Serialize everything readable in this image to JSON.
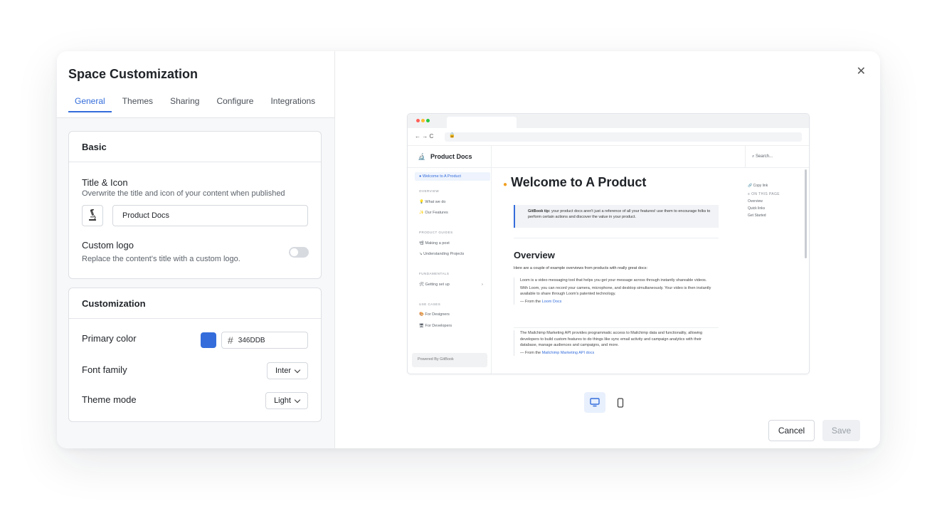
{
  "modal": {
    "title": "Space Customization",
    "tabs": [
      {
        "label": "General",
        "active": true
      },
      {
        "label": "Themes"
      },
      {
        "label": "Sharing"
      },
      {
        "label": "Configure"
      },
      {
        "label": "Integrations"
      }
    ]
  },
  "basic": {
    "heading": "Basic",
    "title_icon_label": "Title & Icon",
    "title_icon_desc": "Overwrite the title and icon of your content when published",
    "title_value": "Product Docs",
    "custom_logo_label": "Custom logo",
    "custom_logo_desc": "Replace the content's title with a custom logo.",
    "custom_logo_enabled": false
  },
  "customization": {
    "heading": "Customization",
    "primary_color_label": "Primary color",
    "primary_color_hex": "346DDB",
    "primary_color_swatch": "#346ddb",
    "font_family_label": "Font family",
    "font_family_value": "Inter",
    "theme_mode_label": "Theme mode",
    "theme_mode_value": "Light"
  },
  "preview": {
    "site_title": "Product Docs",
    "search_placeholder": "Search...",
    "page_title": "Welcome to A Product",
    "sidebar": {
      "active_item": "Welcome to A Product",
      "sections": [
        {
          "caption": "OVERVIEW",
          "items": [
            "What we do",
            "Our Features"
          ]
        },
        {
          "caption": "PRODUCT GUIDES",
          "items": [
            "Making a post",
            "Understanding Projects"
          ]
        },
        {
          "caption": "FUNDAMENTALS",
          "items": [
            "Getting set up"
          ]
        },
        {
          "caption": "USE CASES",
          "items": [
            "For Designers",
            "For Developers"
          ]
        }
      ],
      "powered_by": "Powered By GitBook"
    },
    "hint_bold": "GitBook tip:",
    "hint_text": " your product docs aren't just a reference of all your features! use them to encourage folks to perform certain actions and discover the value in your product.",
    "overview_heading": "Overview",
    "overview_intro": "Here are a couple of example overviews from products with really great docs:",
    "quote1_line1": "Loom is a video messaging tool that helps you get your message across through instantly shareable videos.",
    "quote1_line2": "With Loom, you can record your camera, microphone, and desktop simultaneously. Your video is then instantly available to share through Loom's patented technology.",
    "quote1_from": "— From the ",
    "quote1_link": "Loom Docs",
    "quote2_text": "The Mailchimp Marketing API provides programmatic access to Mailchimp data and functionality, allowing developers to build custom features to do things like sync email activity and campaign analytics with their database, manage audiences and campaigns, and more.",
    "quote2_from": "— From the ",
    "quote2_link": "Mailchimp Marketing API docs",
    "toc": {
      "copy_link": "Copy link",
      "caption": "ON THIS PAGE",
      "items": [
        "Overview",
        "Quick links",
        "Get Started"
      ]
    }
  },
  "footer": {
    "cancel_label": "Cancel",
    "save_label": "Save"
  },
  "colors": {
    "accent": "#346ddb",
    "device_active_bg": "#e8f0fd"
  },
  "icons": [
    "microscope-icon",
    "toggle-switch",
    "hash-icon",
    "chevron-down-icon",
    "close-icon",
    "desktop-icon",
    "mobile-icon"
  ]
}
